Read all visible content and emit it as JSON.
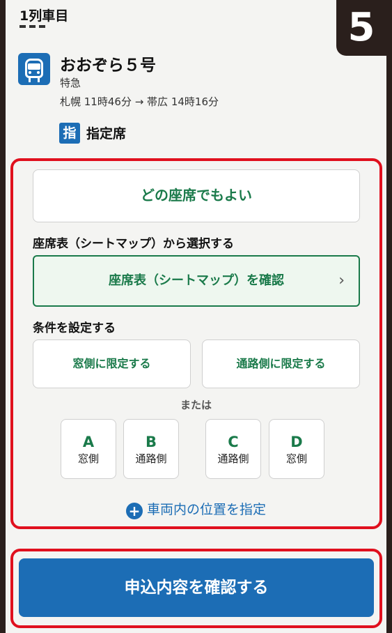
{
  "step_number": "5",
  "car": {
    "label": "1列車目"
  },
  "train": {
    "name": "おおぞら５号",
    "type": "特急",
    "route": "札幌 11時46分 → 帯広 14時16分",
    "seat_kind_badge": "指",
    "seat_kind": "指定席",
    "icon": "train-icon"
  },
  "options": {
    "any_seat_label": "どの座席でもよい",
    "seatmap_section_title": "座席表（シートマップ）から選択する",
    "seatmap_button_label": "座席表（シートマップ）を確認",
    "conditions_section_title": "条件を設定する",
    "window_only_label": "窓側に限定する",
    "aisle_only_label": "通路側に限定する",
    "or_label": "または",
    "seats": [
      {
        "letter": "A",
        "position": "窓側"
      },
      {
        "letter": "B",
        "position": "通路側"
      },
      {
        "letter": "C",
        "position": "通路側"
      },
      {
        "letter": "D",
        "position": "窓側"
      }
    ],
    "car_position_link": "車両内の位置を指定"
  },
  "submit_label": "申込内容を確認する",
  "colors": {
    "brand_blue": "#1c6db5",
    "accent_green": "#1a7a4a",
    "highlight_red": "#e0101e"
  }
}
